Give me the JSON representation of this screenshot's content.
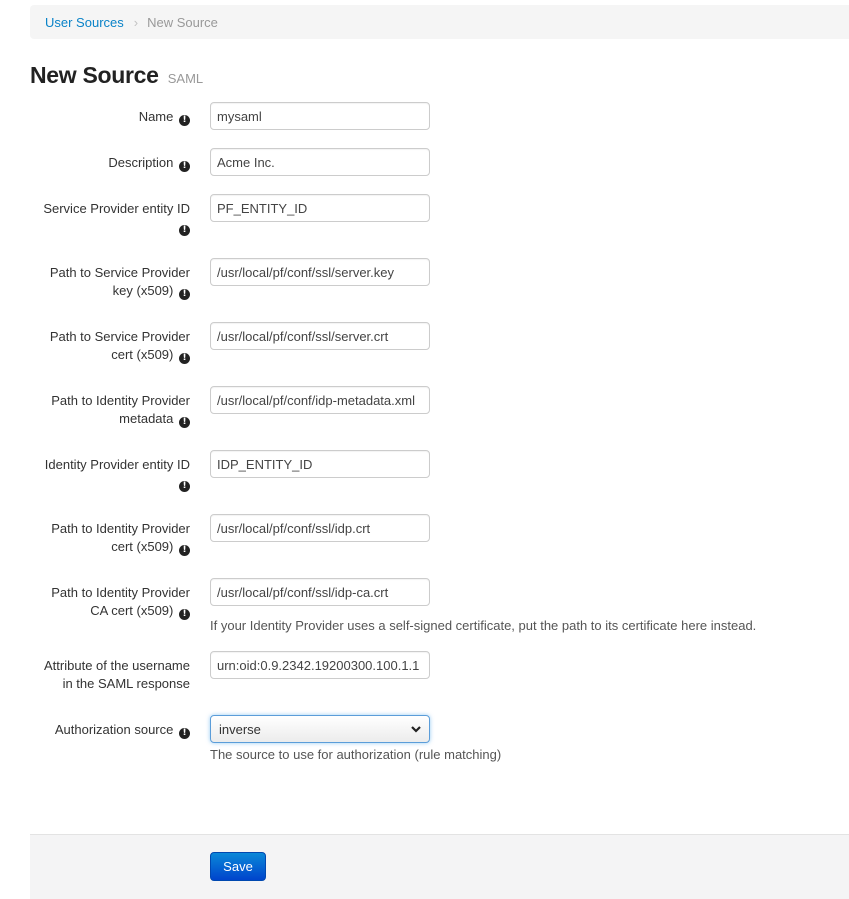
{
  "breadcrumb": {
    "items": [
      {
        "label": "User Sources",
        "link": true
      },
      {
        "label": "New Source",
        "link": false
      }
    ],
    "separator": "›"
  },
  "page": {
    "title": "New Source",
    "subtitle": "SAML"
  },
  "form": {
    "fields": [
      {
        "label_line1": "Name",
        "label_line2": "",
        "value": "mysaml"
      },
      {
        "label_line1": "Description",
        "label_line2": "",
        "value": "Acme Inc."
      },
      {
        "label_line1": "Service Provider entity ID",
        "label_line2": "",
        "value": "PF_ENTITY_ID"
      },
      {
        "label_line1": "Path to Service Provider",
        "label_line2": "key (x509)",
        "value": "/usr/local/pf/conf/ssl/server.key"
      },
      {
        "label_line1": "Path to Service Provider",
        "label_line2": "cert (x509)",
        "value": "/usr/local/pf/conf/ssl/server.crt"
      },
      {
        "label_line1": "Path to Identity Provider",
        "label_line2": "metadata",
        "value": "/usr/local/pf/conf/idp-metadata.xml"
      },
      {
        "label_line1": "Identity Provider entity ID",
        "label_line2": "",
        "value": "IDP_ENTITY_ID"
      },
      {
        "label_line1": "Path to Identity Provider",
        "label_line2": "cert (x509)",
        "value": "/usr/local/pf/conf/ssl/idp.crt"
      },
      {
        "label_line1": "Path to Identity Provider",
        "label_line2": "CA cert (x509)",
        "value": "/usr/local/pf/conf/ssl/idp-ca.crt",
        "help": "If your Identity Provider uses a self-signed certificate, put the path to its certificate here instead."
      },
      {
        "label_line1": "Attribute of the username",
        "label_line2": "in the SAML response",
        "value": "urn:oid:0.9.2342.19200300.100.1.1"
      }
    ],
    "authorization": {
      "label": "Authorization source",
      "selected": "inverse",
      "help": "The source to use for authorization (rule matching)"
    },
    "info_icon_glyph": "!"
  },
  "footer": {
    "save_label": "Save"
  }
}
